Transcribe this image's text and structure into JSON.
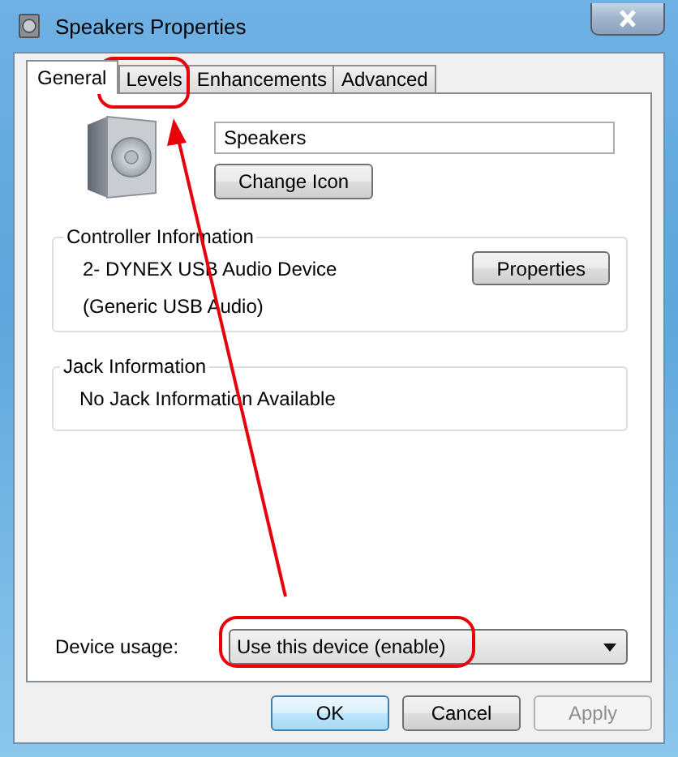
{
  "window": {
    "title": "Speakers Properties"
  },
  "tabs": [
    {
      "label": "General",
      "selected": true
    },
    {
      "label": "Levels",
      "selected": false
    },
    {
      "label": "Enhancements",
      "selected": false
    },
    {
      "label": "Advanced",
      "selected": false
    }
  ],
  "device_name": {
    "value": "Speakers"
  },
  "change_icon_button": "Change Icon",
  "controller_information": {
    "title": "Controller Information",
    "lines": [
      "2- DYNEX USB Audio Device",
      "(Generic USB Audio)"
    ],
    "button": "Properties"
  },
  "jack_information": {
    "title": "Jack Information",
    "text": "No Jack Information Available"
  },
  "device_usage": {
    "label": "Device usage:",
    "value": "Use this device (enable)"
  },
  "buttons": [
    {
      "label": "OK",
      "default": true,
      "disabled": false
    },
    {
      "label": "Cancel",
      "default": false,
      "disabled": false
    },
    {
      "label": "Apply",
      "default": false,
      "disabled": true
    }
  ]
}
